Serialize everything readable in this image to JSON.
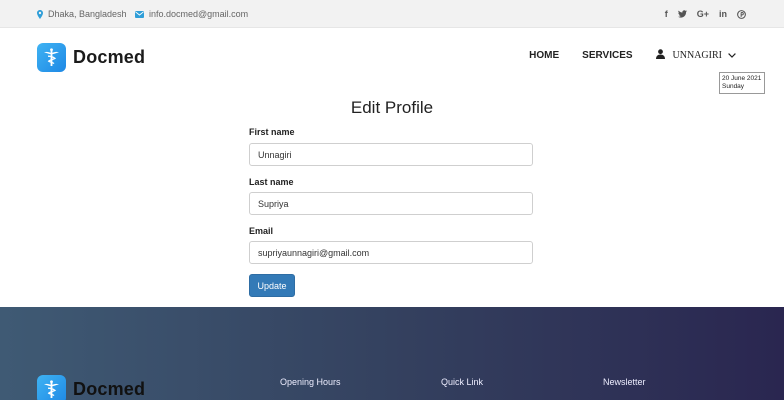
{
  "topbar": {
    "location": "Dhaka, Bangladesh",
    "email": "info.docmed@gmail.com",
    "social": [
      {
        "icon": "facebook-icon",
        "glyph": "f"
      },
      {
        "icon": "twitter-icon",
        "glyph": "🐦"
      },
      {
        "icon": "google-plus-icon",
        "glyph": "G+"
      },
      {
        "icon": "linkedin-icon",
        "glyph": "in"
      },
      {
        "icon": "pinterest-icon",
        "glyph": "℗"
      }
    ]
  },
  "header": {
    "logo_text": "Docmed",
    "nav": {
      "home": "HOME",
      "services": "SERVICES",
      "user": "UNNAGIRI"
    }
  },
  "form": {
    "title": "Edit Profile",
    "first_name_label": "First name",
    "first_name_value": "Unnagiri",
    "last_name_label": "Last name",
    "last_name_value": "Supriya",
    "email_label": "Email",
    "email_value": "supriyaunnagiri@gmail.com",
    "submit_label": "Update"
  },
  "footer": {
    "logo_text": "Docmed",
    "opening_hours": "Opening Hours",
    "quick_link": "Quick Link",
    "newsletter": "Newsletter"
  },
  "date_badge": {
    "date": "20 June 2021",
    "day": "Sunday"
  },
  "colors": {
    "accent": "#337ab7",
    "logo": "#2196f3",
    "topbar_icon": "#2f9ed8"
  }
}
